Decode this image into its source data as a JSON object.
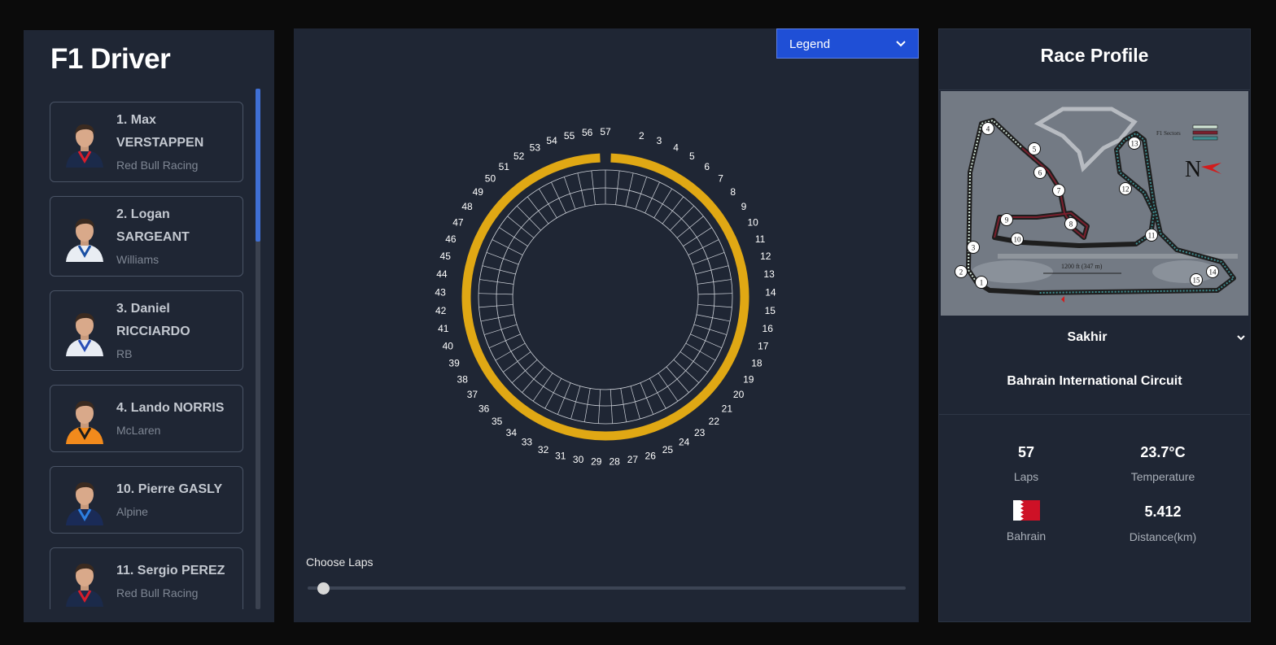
{
  "driver_panel": {
    "title": "F1 Driver",
    "drivers": [
      {
        "name_line1": "1. Max",
        "name_line2": "VERSTAPPEN",
        "team": "Red Bull Racing",
        "suit_color": "#1b2a4a",
        "accent_color": "#d61d2b"
      },
      {
        "name_line1": "2. Logan",
        "name_line2": "SARGEANT",
        "team": "Williams",
        "suit_color": "#e9edf3",
        "accent_color": "#1a4fa3"
      },
      {
        "name_line1": "3. Daniel",
        "name_line2": "RICCIARDO",
        "team": "RB",
        "suit_color": "#e8ecf3",
        "accent_color": "#2a4fb7"
      },
      {
        "name_line1": "4. Lando NORRIS",
        "name_line2": "",
        "team": "McLaren",
        "suit_color": "#f28a1c",
        "accent_color": "#1c1c1c"
      },
      {
        "name_line1": "10. Pierre GASLY",
        "name_line2": "",
        "team": "Alpine",
        "suit_color": "#1a2b57",
        "accent_color": "#2d7fe0"
      },
      {
        "name_line1": "11. Sergio PEREZ",
        "name_line2": "",
        "team": "Red Bull Racing",
        "suit_color": "#1b2a4a",
        "accent_color": "#d61d2b"
      }
    ]
  },
  "lap_chart": {
    "legend_label": "Legend",
    "laps": [
      "2",
      "3",
      "4",
      "5",
      "6",
      "7",
      "8",
      "9",
      "10",
      "11",
      "12",
      "13",
      "14",
      "15",
      "16",
      "17",
      "18",
      "19",
      "20",
      "21",
      "22",
      "23",
      "24",
      "25",
      "26",
      "27",
      "28",
      "29",
      "30",
      "31",
      "32",
      "33",
      "34",
      "35",
      "36",
      "37",
      "38",
      "39",
      "40",
      "41",
      "42",
      "43",
      "44",
      "45",
      "46",
      "47",
      "48",
      "49",
      "50",
      "51",
      "52",
      "53",
      "54",
      "55",
      "56",
      "57"
    ],
    "total_laps": 57,
    "ring_color": "#e0a814",
    "choose_laps_label": "Choose Laps",
    "slider_value": 1
  },
  "race_profile": {
    "title": "Race Profile",
    "location": "Sakhir",
    "circuit": "Bahrain International Circuit",
    "stats": {
      "laps_value": "57",
      "laps_label": "Laps",
      "temperature_value": "23.7°C",
      "temperature_label": "Temperature",
      "country_label": "Bahrain",
      "distance_value": "5.412",
      "distance_label": "Distance(km)"
    },
    "map": {
      "turns": [
        "1",
        "2",
        "3",
        "4",
        "5",
        "6",
        "7",
        "8",
        "9",
        "10",
        "11",
        "12",
        "13",
        "14",
        "15"
      ],
      "north_label": "N",
      "sectors_label": "F1 Sectors",
      "scale_label": "1200 ft (347 m)"
    }
  }
}
